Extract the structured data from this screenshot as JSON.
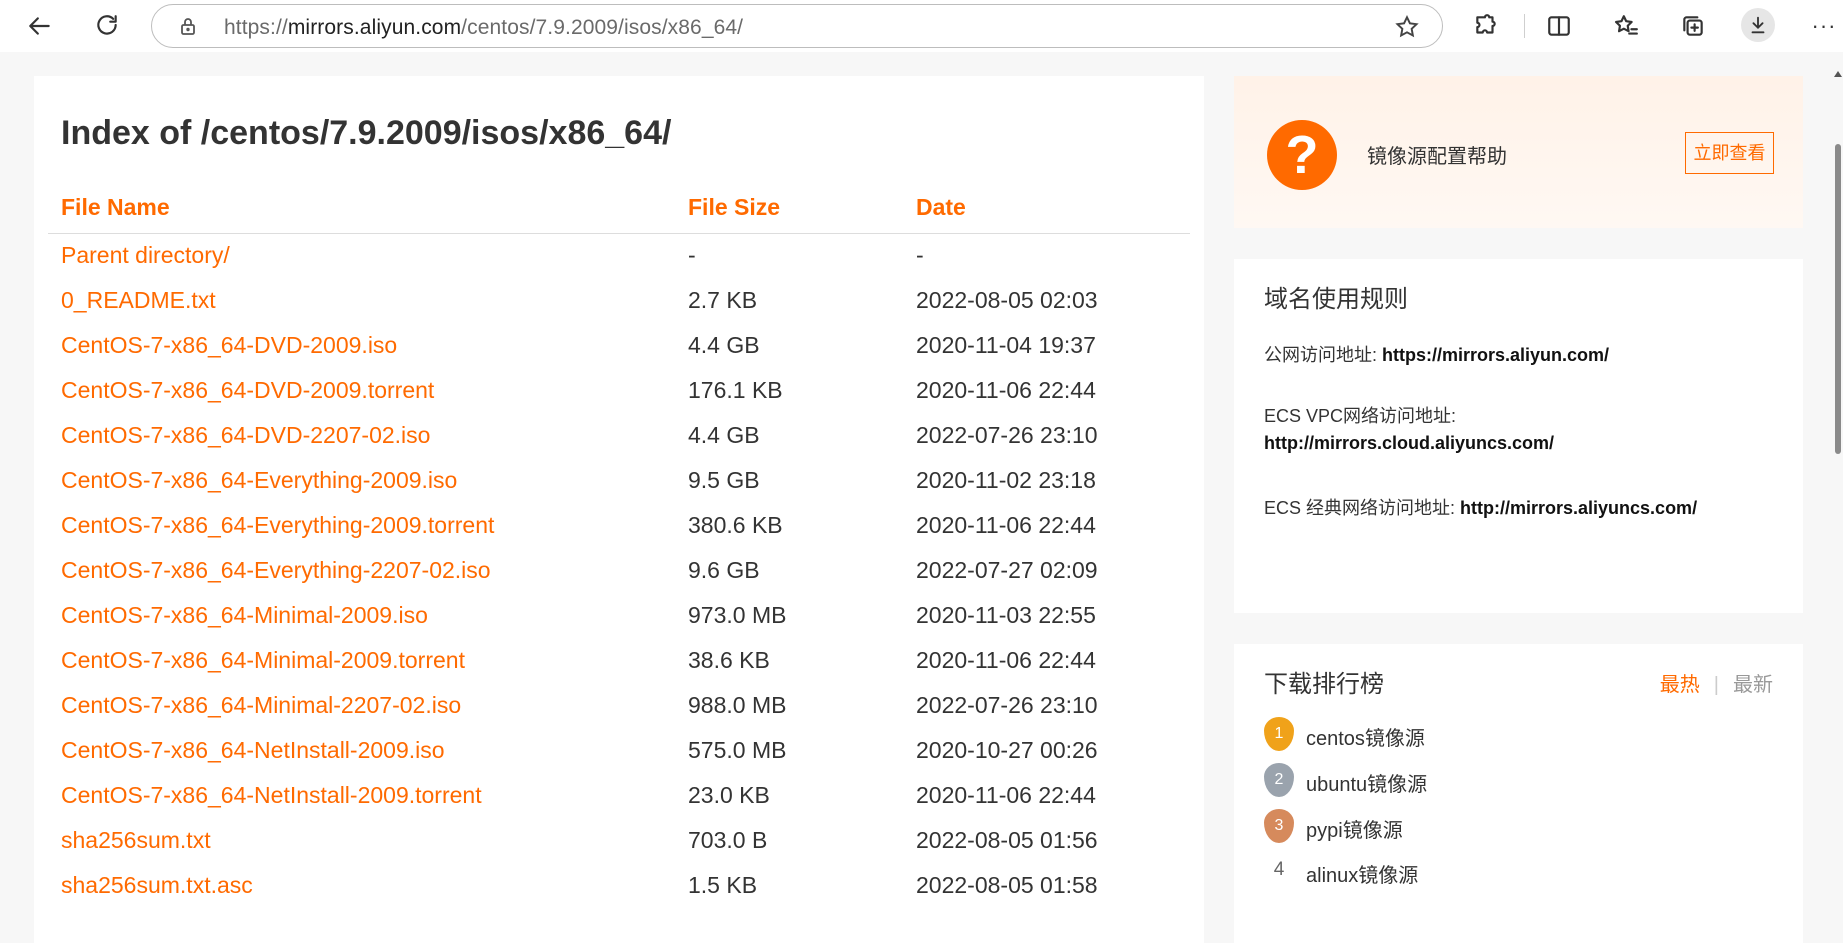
{
  "browser": {
    "url_prefix": "https://",
    "url_domain": "mirrors.aliyun.com",
    "url_path": "/centos/7.9.2009/isos/x86_64/",
    "more_label": "···"
  },
  "main": {
    "title": "Index of /centos/7.9.2009/isos/x86_64/",
    "headers": {
      "name": "File Name",
      "size": "File Size",
      "date": "Date"
    },
    "rows": [
      {
        "name": "Parent directory/",
        "size": "-",
        "date": "-"
      },
      {
        "name": "0_README.txt",
        "size": "2.7 KB",
        "date": "2022-08-05 02:03"
      },
      {
        "name": "CentOS-7-x86_64-DVD-2009.iso",
        "size": "4.4 GB",
        "date": "2020-11-04 19:37"
      },
      {
        "name": "CentOS-7-x86_64-DVD-2009.torrent",
        "size": "176.1 KB",
        "date": "2020-11-06 22:44"
      },
      {
        "name": "CentOS-7-x86_64-DVD-2207-02.iso",
        "size": "4.4 GB",
        "date": "2022-07-26 23:10"
      },
      {
        "name": "CentOS-7-x86_64-Everything-2009.iso",
        "size": "9.5 GB",
        "date": "2020-11-02 23:18"
      },
      {
        "name": "CentOS-7-x86_64-Everything-2009.torrent",
        "size": "380.6 KB",
        "date": "2020-11-06 22:44"
      },
      {
        "name": "CentOS-7-x86_64-Everything-2207-02.iso",
        "size": "9.6 GB",
        "date": "2022-07-27 02:09"
      },
      {
        "name": "CentOS-7-x86_64-Minimal-2009.iso",
        "size": "973.0 MB",
        "date": "2020-11-03 22:55"
      },
      {
        "name": "CentOS-7-x86_64-Minimal-2009.torrent",
        "size": "38.6 KB",
        "date": "2020-11-06 22:44"
      },
      {
        "name": "CentOS-7-x86_64-Minimal-2207-02.iso",
        "size": "988.0 MB",
        "date": "2022-07-26 23:10"
      },
      {
        "name": "CentOS-7-x86_64-NetInstall-2009.iso",
        "size": "575.0 MB",
        "date": "2020-10-27 00:26"
      },
      {
        "name": "CentOS-7-x86_64-NetInstall-2009.torrent",
        "size": "23.0 KB",
        "date": "2020-11-06 22:44"
      },
      {
        "name": "sha256sum.txt",
        "size": "703.0 B",
        "date": "2022-08-05 01:56"
      },
      {
        "name": "sha256sum.txt.asc",
        "size": "1.5 KB",
        "date": "2022-08-05 01:58"
      }
    ]
  },
  "help": {
    "icon_glyph": "?",
    "text": "镜像源配置帮助",
    "button_label": "立即查看"
  },
  "rules": {
    "title": "域名使用规则",
    "public_label": "公网访问地址: ",
    "public_url": "https://mirrors.aliyun.com/",
    "vpc_label": "ECS VPC网络访问地址:",
    "vpc_url": "http://mirrors.cloud.aliyuncs.com/",
    "classic_label": "ECS 经典网络访问地址: ",
    "classic_url": "http://mirrors.aliyuncs.com/"
  },
  "rank": {
    "title": "下载排行榜",
    "tab_hot": "最热",
    "tab_sep": "|",
    "tab_new": "最新",
    "items": [
      {
        "rank": "1",
        "label": "centos镜像源",
        "color": "#f0a21a"
      },
      {
        "rank": "2",
        "label": "ubuntu镜像源",
        "color": "#9aa3ad"
      },
      {
        "rank": "3",
        "label": "pypi镜像源",
        "color": "#d68a5c"
      },
      {
        "rank": "4",
        "label": "alinux镜像源"
      }
    ]
  },
  "colors": {
    "accent": "#ff6a00",
    "text": "#333333"
  }
}
